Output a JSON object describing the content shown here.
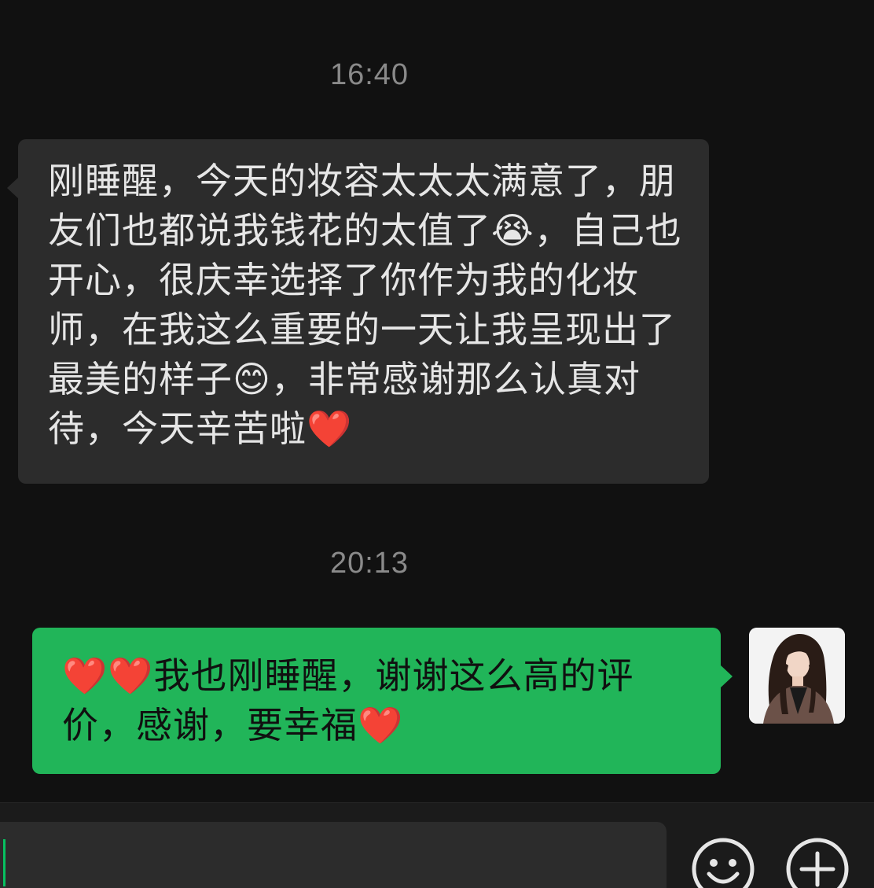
{
  "timestamps": [
    "16:40",
    "20:13"
  ],
  "messages": [
    {
      "direction": "incoming",
      "text": "刚睡醒，今天的妆容太太太满意了，朋友们也都说我钱花的太值了😭，自己也开心，很庆幸选择了你作为我的化妆师，在我这么重要的一天让我呈现出了最美的样子😊，非常感谢那么认真对待，今天辛苦啦❤️"
    },
    {
      "direction": "outgoing",
      "text": "❤️❤️我也刚睡醒，谢谢这么高的评价，感谢，要幸福❤️"
    }
  ],
  "avatar": {
    "icon": "user-avatar-photo"
  },
  "input_bar": {
    "input_value": "",
    "emoji_icon": "smiley-face-icon",
    "plus_icon": "plus-circle-icon"
  },
  "colors": {
    "background": "#111111",
    "incoming_bubble": "#2c2c2c",
    "outgoing_bubble": "#21b559",
    "timestamp_text": "#8a8a8a"
  }
}
